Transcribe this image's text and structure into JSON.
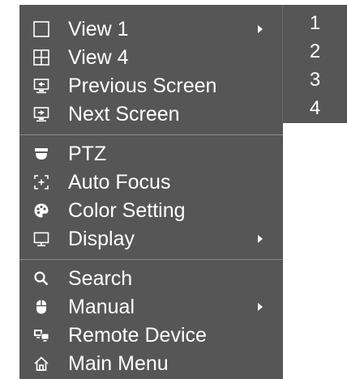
{
  "context_menu": {
    "groups": [
      {
        "items": [
          {
            "label": "View 1",
            "icon": "single-window-icon",
            "has_submenu": true
          },
          {
            "label": "View 4",
            "icon": "quad-grid-icon",
            "has_submenu": false
          },
          {
            "label": "Previous Screen",
            "icon": "previous-screen-icon",
            "has_submenu": false
          },
          {
            "label": "Next Screen",
            "icon": "next-screen-icon",
            "has_submenu": false
          }
        ]
      },
      {
        "items": [
          {
            "label": "PTZ",
            "icon": "ptz-camera-icon",
            "has_submenu": false
          },
          {
            "label": "Auto Focus",
            "icon": "auto-focus-icon",
            "has_submenu": false
          },
          {
            "label": "Color Setting",
            "icon": "palette-icon",
            "has_submenu": false
          },
          {
            "label": "Display",
            "icon": "monitor-icon",
            "has_submenu": true
          }
        ]
      },
      {
        "items": [
          {
            "label": "Search",
            "icon": "search-icon",
            "has_submenu": false
          },
          {
            "label": "Manual",
            "icon": "mouse-icon",
            "has_submenu": true
          },
          {
            "label": "Remote Device",
            "icon": "remote-device-icon",
            "has_submenu": false
          },
          {
            "label": "Main Menu",
            "icon": "home-icon",
            "has_submenu": false
          }
        ]
      }
    ]
  },
  "view1_submenu": {
    "items": [
      "1",
      "2",
      "3",
      "4"
    ]
  },
  "colors": {
    "menu_background": "#565656",
    "divider": "#8a8a8a",
    "text": "#ffffff"
  }
}
